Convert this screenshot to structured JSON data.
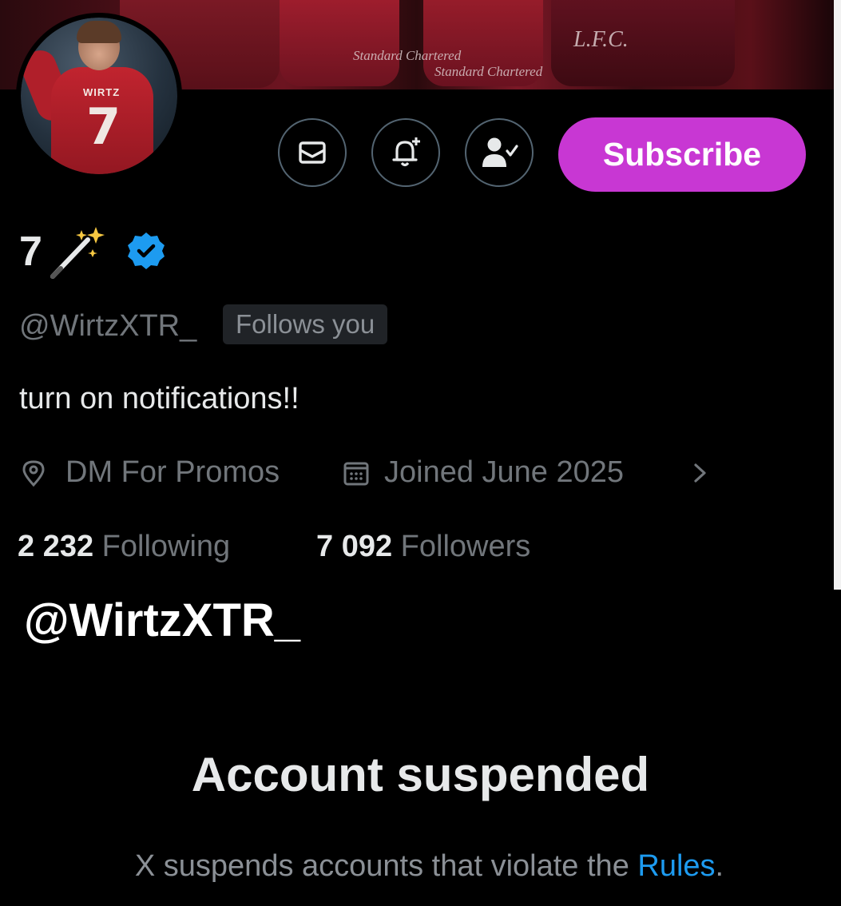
{
  "profile": {
    "banner_sponsor_1": "Standard Chartered",
    "banner_sponsor_2": "Standard Chartered",
    "banner_club": "L.F.C.",
    "avatar_shirt_name": "WIRTZ",
    "avatar_shirt_number": "7",
    "actions": {
      "message_icon": "envelope-icon",
      "notify_icon": "bell-plus-icon",
      "following_icon": "person-check-icon",
      "subscribe_label": "Subscribe"
    },
    "display_name": "7",
    "display_name_emoji": "magic-wand-icon",
    "verified_icon": "verified-badge-icon",
    "handle": "@WirtzXTR_",
    "follows_you": "Follows you",
    "bio": "turn on notifications!!",
    "location_icon": "location-pin-icon",
    "location": "DM For Promos",
    "joined_icon": "calendar-icon",
    "joined": "Joined June 2025",
    "more_icon": "chevron-right-icon",
    "following_count": "2 232",
    "following_label": "Following",
    "followers_count": "7 092",
    "followers_label": "Followers"
  },
  "suspended": {
    "handle": "@WirtzXTR_",
    "title": "Account suspended",
    "message_prefix": "X suspends accounts that violate the ",
    "rules_link": "Rules",
    "message_suffix": "."
  },
  "colors": {
    "background": "#000000",
    "subscribe": "#c837d3",
    "verified": "#1d9bf0",
    "muted_text": "#71767b",
    "link": "#1d9bf0"
  }
}
